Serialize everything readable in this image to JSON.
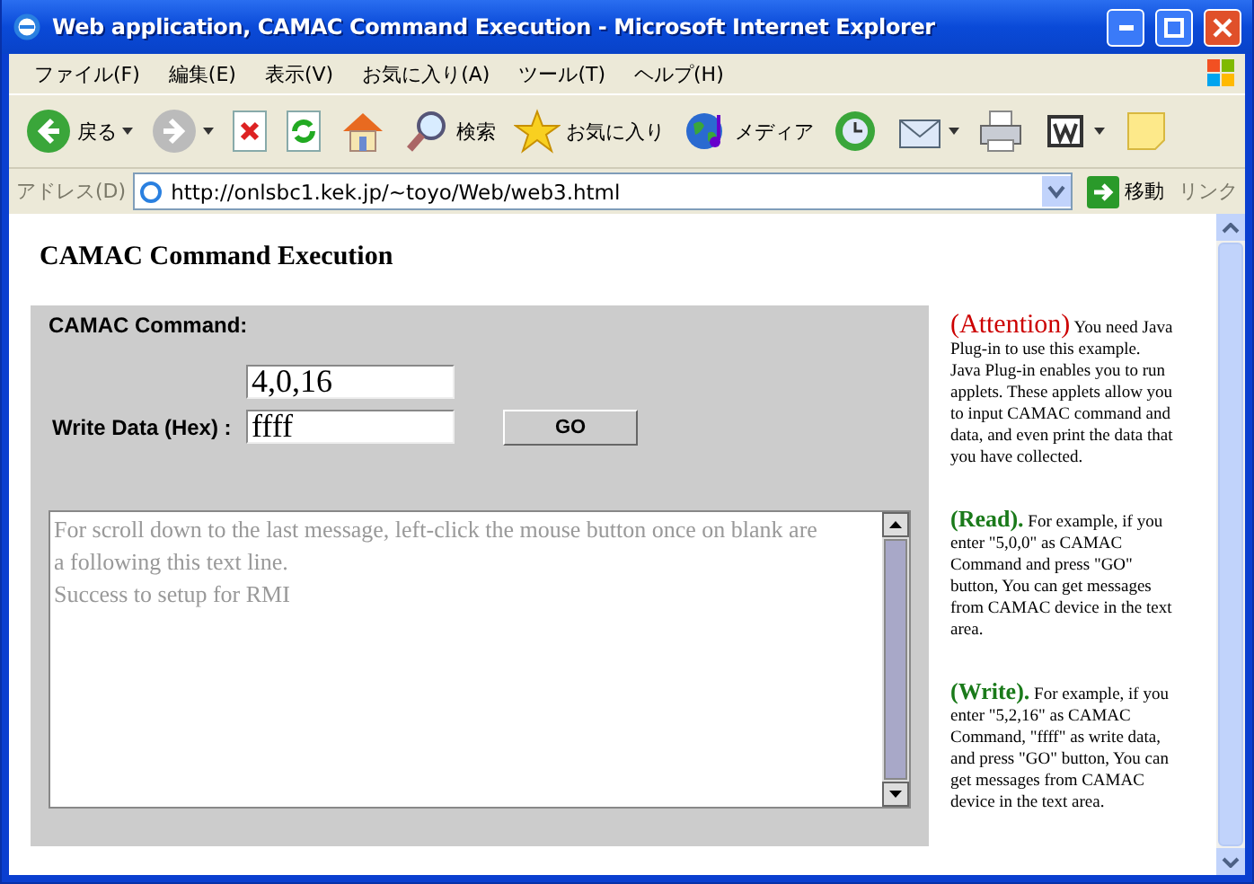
{
  "window": {
    "title": "Web application, CAMAC Command Execution - Microsoft Internet Explorer"
  },
  "menu": [
    "ファイル(F)",
    "編集(E)",
    "表示(V)",
    "お気に入り(A)",
    "ツール(T)",
    "ヘルプ(H)"
  ],
  "toolbar": [
    {
      "kind": "back",
      "label": "戻る",
      "dropdown": true
    },
    {
      "kind": "forward",
      "dropdown": true
    },
    {
      "kind": "stop",
      "dropdown": false
    },
    {
      "kind": "refresh",
      "dropdown": false
    },
    {
      "kind": "home",
      "dropdown": false
    },
    {
      "kind": "search",
      "label": "検索",
      "dropdown": false
    },
    {
      "kind": "favorites",
      "label": "お気に入り",
      "dropdown": false
    },
    {
      "kind": "media",
      "label": "メディア",
      "dropdown": false
    },
    {
      "kind": "history",
      "dropdown": false
    },
    {
      "kind": "mail",
      "dropdown": true
    },
    {
      "kind": "print",
      "dropdown": false
    },
    {
      "kind": "word",
      "dropdown": true
    },
    {
      "kind": "note",
      "dropdown": false
    }
  ],
  "address_bar": {
    "label": "アドレス(D)",
    "url": "http://onlsbc1.kek.jp/~toyo/Web/web3.html",
    "go": "移動",
    "links": "リンク"
  },
  "page": {
    "heading": "CAMAC Command Execution",
    "panel": {
      "command_label": "CAMAC Command:",
      "command_value": "4,0,16",
      "write_label": "Write Data (Hex) :",
      "write_value": "ffff",
      "go_button": "GO",
      "messages": [
        "For scroll down to the last message, left-click the mouse button once on blank are",
        "a following this text line.",
        "Success to setup for RMI"
      ]
    },
    "notes": [
      {
        "tag": "(Attention)",
        "color": "#cc0000",
        "text": "You need Java Plug-in to use this example. Java Plug-in enables you to run applets. These applets allow you to input CAMAC command and data, and even print the data that you have collected."
      },
      {
        "tag": "(Read).",
        "color": "#1a7a1a",
        "text": "For example, if you enter \"5,0,0\" as CAMAC Command and press \"GO\" button, You can get messages from CAMAC device in the text area."
      },
      {
        "tag": "(Write).",
        "color": "#1a7a1a",
        "text": "For example, if you enter \"5,2,16\" as CAMAC Command, \"ffff\" as write data, and press \"GO\" button, You can get messages from CAMAC device in the text area."
      }
    ]
  }
}
